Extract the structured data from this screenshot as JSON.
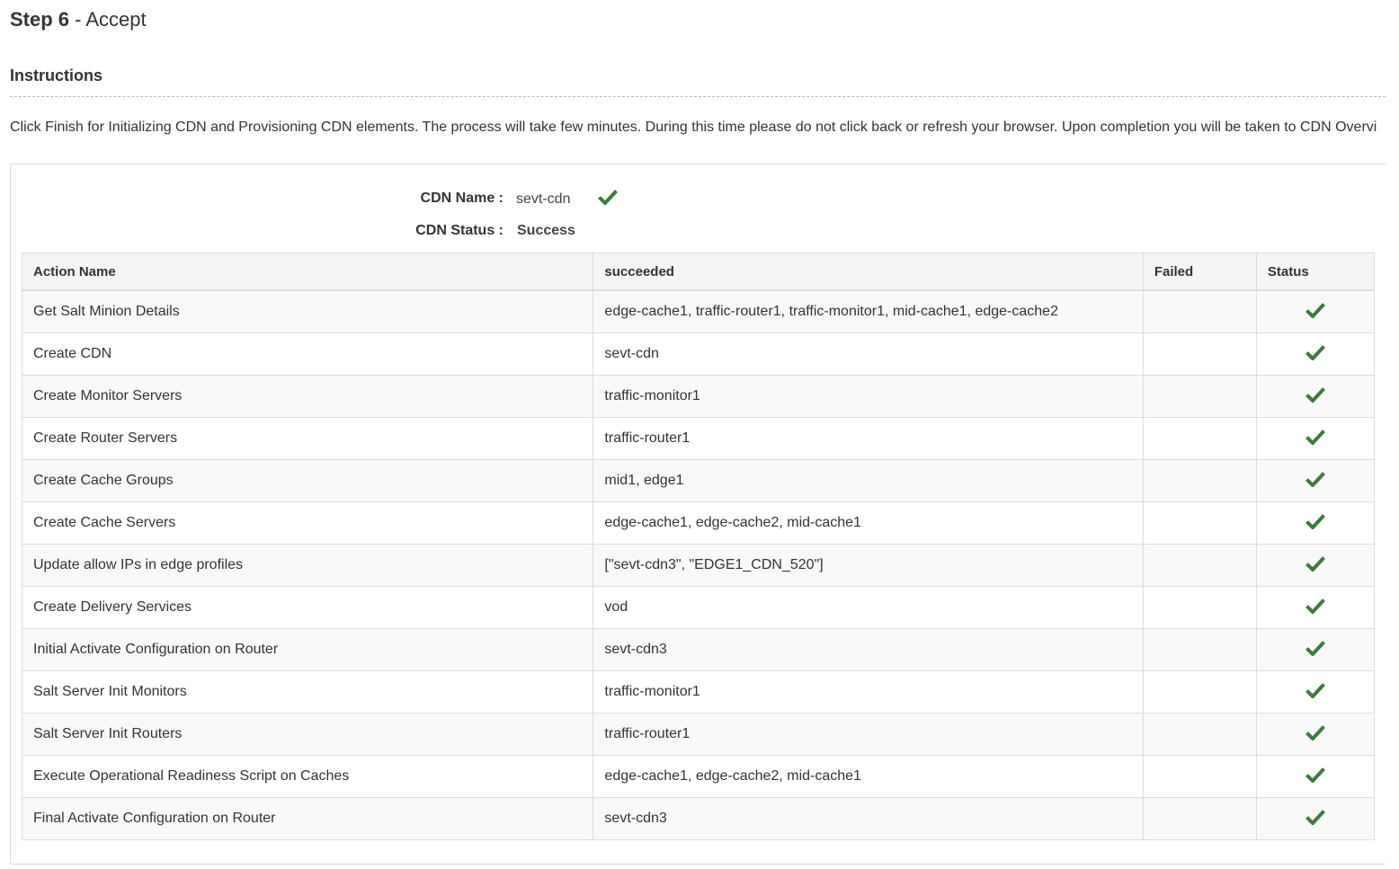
{
  "step": {
    "number": "Step 6",
    "separator": " - ",
    "name": "Accept"
  },
  "instructions": {
    "title": "Instructions",
    "text": "Click Finish for Initializing CDN and Provisioning CDN elements. The process will take few minutes. During this time please do not click back or refresh your browser. Upon completion you will be taken to CDN Overvi"
  },
  "summary": {
    "cdn_name_label": "CDN Name :",
    "cdn_name_value": "sevt-cdn",
    "cdn_status_label": "CDN Status :",
    "cdn_status_value": "Success",
    "name_check_icon": "check-icon"
  },
  "table": {
    "headers": {
      "action_name": "Action Name",
      "succeeded": "succeeded",
      "failed": "Failed",
      "status": "Status"
    },
    "rows": [
      {
        "action": "Get Salt Minion Details",
        "succeeded": "edge-cache1, traffic-router1, traffic-monitor1, mid-cache1, edge-cache2",
        "failed": "",
        "status_icon": "check-icon"
      },
      {
        "action": "Create CDN",
        "succeeded": "sevt-cdn",
        "failed": "",
        "status_icon": "check-icon"
      },
      {
        "action": "Create Monitor Servers",
        "succeeded": "traffic-monitor1",
        "failed": "",
        "status_icon": "check-icon"
      },
      {
        "action": "Create Router Servers",
        "succeeded": "traffic-router1",
        "failed": "",
        "status_icon": "check-icon"
      },
      {
        "action": "Create Cache Groups",
        "succeeded": "mid1, edge1",
        "failed": "",
        "status_icon": "check-icon"
      },
      {
        "action": "Create Cache Servers",
        "succeeded": "edge-cache1, edge-cache2, mid-cache1",
        "failed": "",
        "status_icon": "check-icon"
      },
      {
        "action": "Update allow IPs in edge profiles",
        "succeeded": "[\"sevt-cdn3\", \"EDGE1_CDN_520\"]",
        "failed": "",
        "status_icon": "check-icon"
      },
      {
        "action": "Create Delivery Services",
        "succeeded": "vod",
        "failed": "",
        "status_icon": "check-icon"
      },
      {
        "action": "Initial Activate Configuration on Router",
        "succeeded": "sevt-cdn3",
        "failed": "",
        "status_icon": "check-icon"
      },
      {
        "action": "Salt Server Init Monitors",
        "succeeded": "traffic-monitor1",
        "failed": "",
        "status_icon": "check-icon"
      },
      {
        "action": "Salt Server Init Routers",
        "succeeded": "traffic-router1",
        "failed": "",
        "status_icon": "check-icon"
      },
      {
        "action": "Execute Operational Readiness Script on Caches",
        "succeeded": "edge-cache1, edge-cache2, mid-cache1",
        "failed": "",
        "status_icon": "check-icon"
      },
      {
        "action": "Final Activate Configuration on Router",
        "succeeded": "sevt-cdn3",
        "failed": "",
        "status_icon": "check-icon"
      }
    ]
  },
  "colors": {
    "success_check": "#3d7a3d",
    "text": "#333333",
    "border": "#dddddd"
  }
}
